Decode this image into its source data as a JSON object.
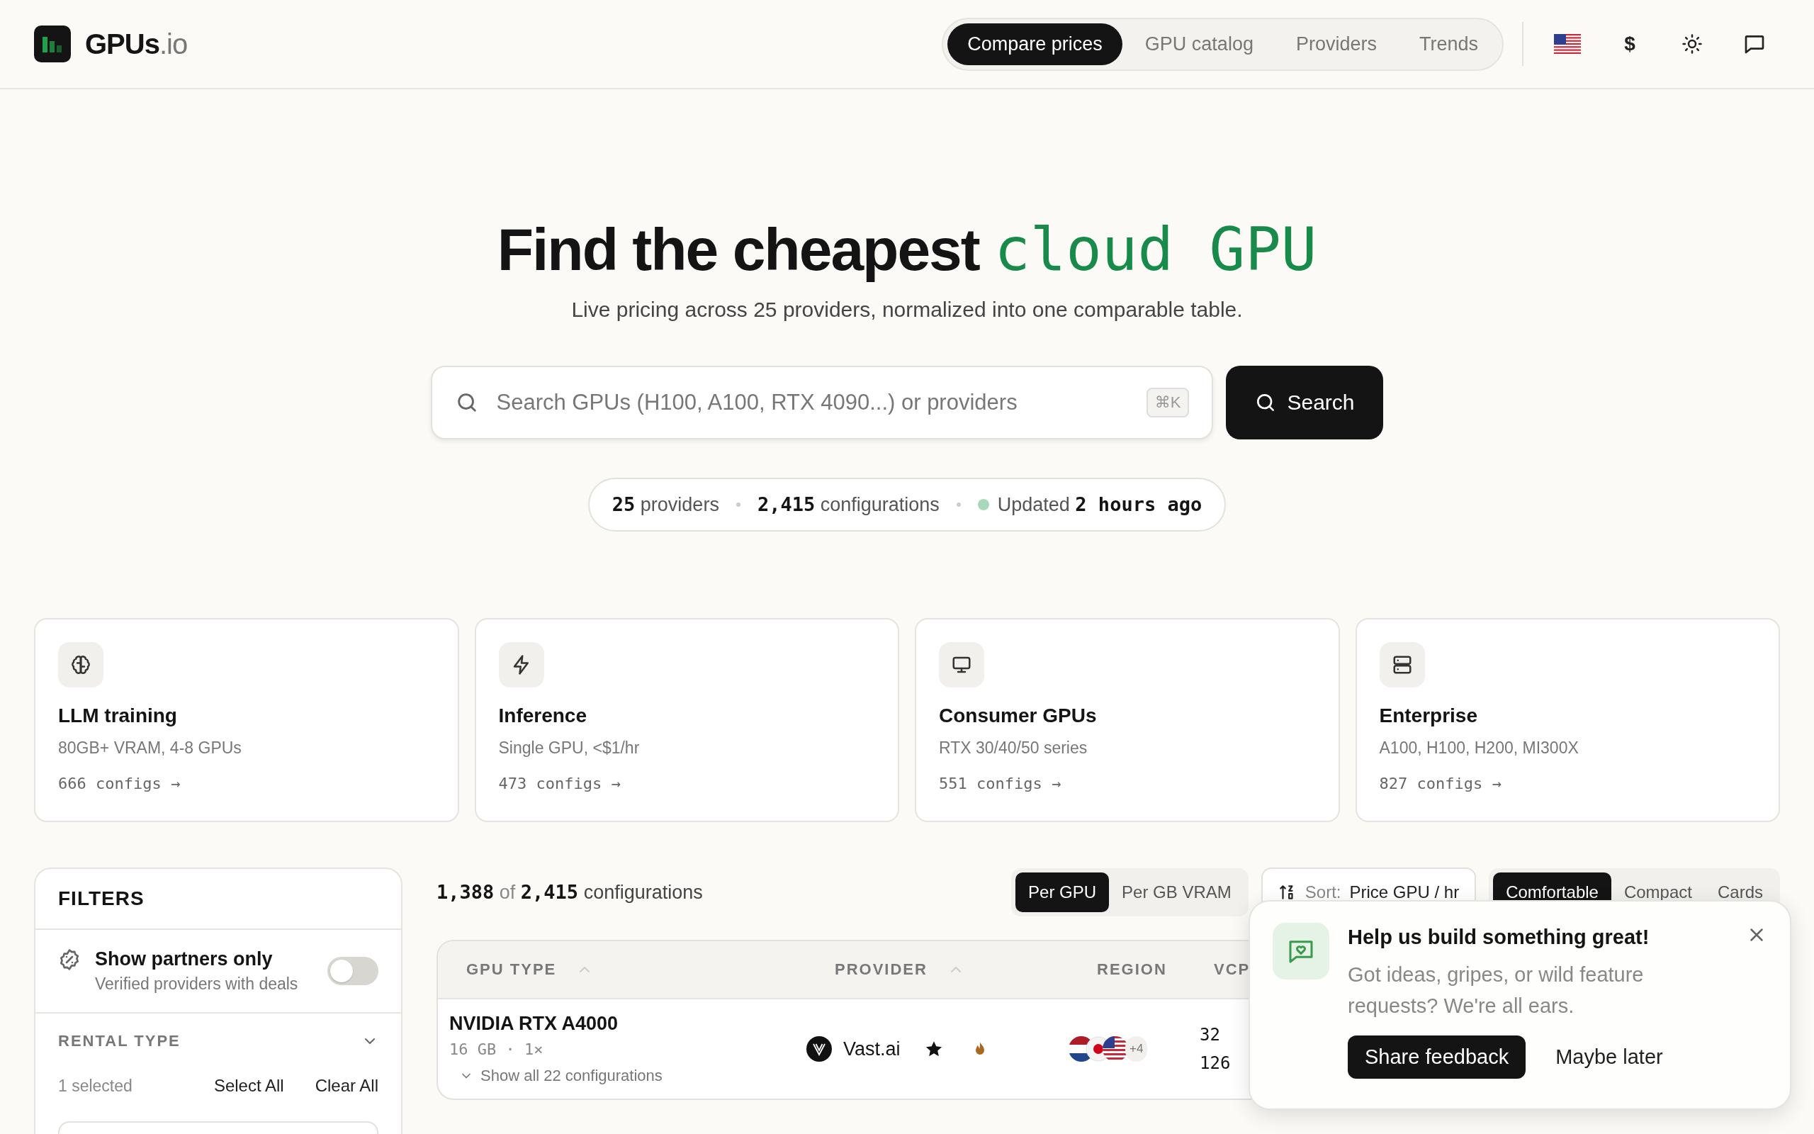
{
  "header": {
    "logo": {
      "name": "GPUs",
      "suffix": ".io"
    },
    "nav": [
      {
        "label": "Compare prices",
        "selected": true
      },
      {
        "label": "GPU catalog",
        "selected": false
      },
      {
        "label": "Providers",
        "selected": false
      },
      {
        "label": "Trends",
        "selected": false
      }
    ],
    "currency": "$"
  },
  "hero": {
    "title": "Find the cheapest",
    "accent": "cloud GPU",
    "subtitle": "Live pricing across 25 providers, normalized into one comparable table.",
    "search": {
      "placeholder": "Search GPUs (H100, A100, RTX 4090...) or providers",
      "shortcut": "⌘K",
      "button": "Search"
    },
    "stats": [
      {
        "value": "25",
        "label": "providers"
      },
      {
        "value": "2,415",
        "label": "configurations"
      }
    ],
    "updated": {
      "label": "Updated",
      "value": "2 hours ago"
    }
  },
  "use_cases": [
    {
      "kind": "brain",
      "title": "LLM training",
      "subtitle": "80GB+ VRAM, 4-8 GPUs",
      "count": "666 configs →"
    },
    {
      "kind": "bolt",
      "title": "Inference",
      "subtitle": "Single GPU, <$1/hr",
      "count": "473 configs →"
    },
    {
      "kind": "monitor",
      "title": "Consumer GPUs",
      "subtitle": "RTX 30/40/50 series",
      "count": "551 configs →"
    },
    {
      "kind": "server",
      "title": "Enterprise",
      "subtitle": "A100, H100, H200, MI300X",
      "count": "827 configs →"
    }
  ],
  "filters": {
    "title": "FILTERS",
    "partners": {
      "label": "Show partners only",
      "hint": "Verified providers with deals",
      "on": false
    },
    "section": {
      "title": "RENTAL TYPE",
      "expanded": true,
      "count": "1 selected",
      "actions": [
        "Select All",
        "Clear All"
      ]
    }
  },
  "results": {
    "shown": "1,388",
    "of": "of",
    "total": "2,415",
    "label": "configurations",
    "units": [
      {
        "label": "Per GPU",
        "selected": true
      },
      {
        "label": "Per GB VRAM",
        "selected": false
      }
    ],
    "sort": {
      "label": "Sort:",
      "value": "Price GPU / hr"
    },
    "views": [
      {
        "label": "Comfortable",
        "selected": true
      },
      {
        "label": "Compact",
        "selected": false
      },
      {
        "label": "Cards",
        "selected": false
      }
    ]
  },
  "table": {
    "columns": [
      {
        "label": "GPU TYPE",
        "sortable": true
      },
      {
        "label": "PROVIDER",
        "sortable": true
      },
      {
        "label": "REGION",
        "sortable": false
      },
      {
        "label": "VCP",
        "sortable": false
      }
    ],
    "rows": [
      {
        "gpu": "NVIDIA RTX A4000",
        "specs": "16 GB · 1×",
        "expand": "Show all 22 configurations",
        "provider": "Vast.ai",
        "more_regions": "+4",
        "vcpu": [
          "32",
          "126"
        ]
      }
    ]
  },
  "popup": {
    "title": "Help us build something great!",
    "text": "Got ideas, gripes, or wild feature requests? We're all ears.",
    "primary": "Share feedback",
    "secondary": "Maybe later"
  }
}
